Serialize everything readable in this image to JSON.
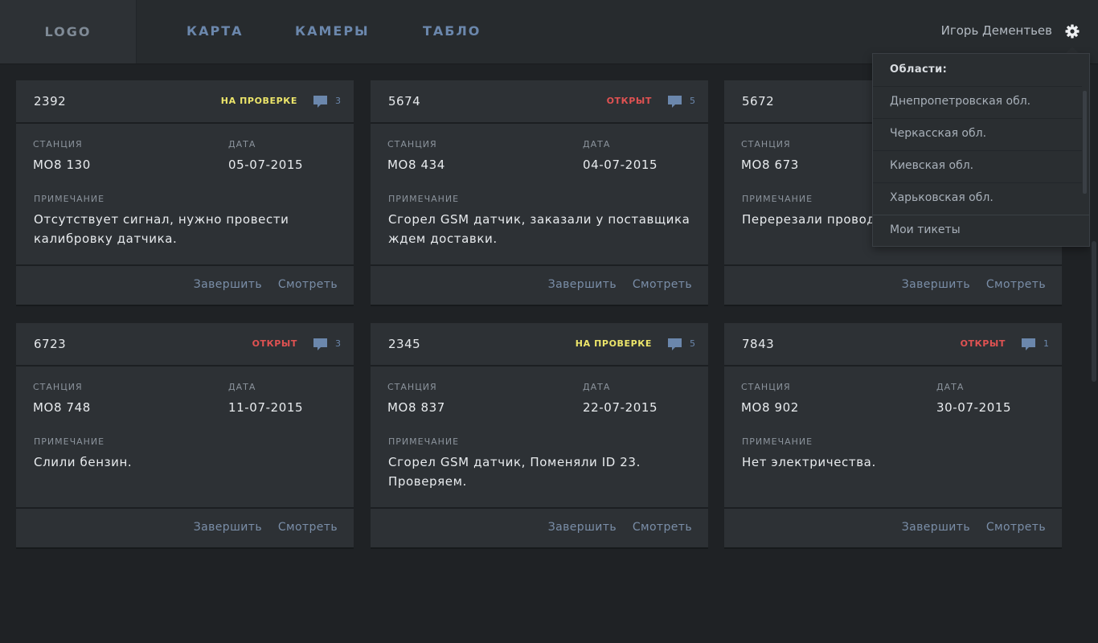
{
  "header": {
    "logo": "LOGO",
    "nav": [
      "КАРТА",
      "КАМЕРЫ",
      "ТАБЛО"
    ],
    "user_name": "Игорь Дементьев",
    "settings_icon": "gear-icon"
  },
  "dropdown": {
    "title": "Области:",
    "items": [
      "Днепропетровская обл.",
      "Черкасская обл.",
      "Киевская обл.",
      "Харьковская обл."
    ],
    "footer_item": "Мои тикеты"
  },
  "labels": {
    "station": "СТАНЦИЯ",
    "date": "ДАТА",
    "note": "ПРИМЕЧАНИЕ",
    "finish": "Завершить",
    "view": "Смотреть"
  },
  "colors": {
    "status_review": "#ece56a",
    "status_open": "#e05252",
    "accent": "#6b87ac"
  },
  "cards": [
    {
      "id": "2392",
      "status": "НА ПРОВЕРКЕ",
      "status_type": "review",
      "comments": "3",
      "station": "MO8 130",
      "date": "05-07-2015",
      "note": "Отсутствует сигнал, нужно провести калибровку датчика."
    },
    {
      "id": "5674",
      "status": "ОТКРЫТ",
      "status_type": "open",
      "comments": "5",
      "station": "MO8 434",
      "date": "04-07-2015",
      "note": "Сгорел GSM датчик, заказали у поставщика ждем доставки."
    },
    {
      "id": "5672",
      "status": "",
      "status_type": "",
      "comments": "",
      "station": "MO8 673",
      "date": "",
      "note": "Перерезали провод и замену."
    },
    {
      "id": "6723",
      "status": "ОТКРЫТ",
      "status_type": "open",
      "comments": "3",
      "station": "MO8 748",
      "date": "11-07-2015",
      "note": "Слили бензин."
    },
    {
      "id": "2345",
      "status": "НА ПРОВЕРКЕ",
      "status_type": "review",
      "comments": "5",
      "station": "MO8 837",
      "date": "22-07-2015",
      "note": "Сгорел GSM датчик, Поменяли ID 23. Проверяем."
    },
    {
      "id": "7843",
      "status": "ОТКРЫТ",
      "status_type": "open",
      "comments": "1",
      "station": "MO8 902",
      "date": "30-07-2015",
      "note": "Нет электричества."
    }
  ]
}
